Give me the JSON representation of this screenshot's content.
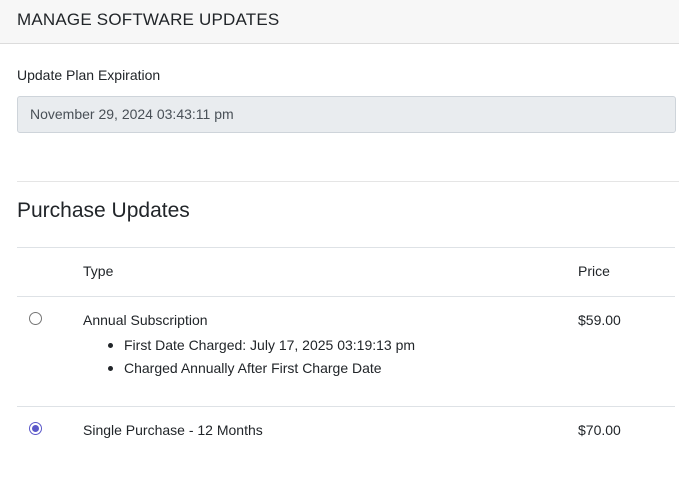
{
  "header": {
    "title": "MANAGE SOFTWARE UPDATES"
  },
  "expiration": {
    "label": "Update Plan Expiration",
    "value": "November 29, 2024 03:43:11 pm"
  },
  "purchase": {
    "title": "Purchase Updates",
    "columns": {
      "type": "Type",
      "price": "Price"
    },
    "options": [
      {
        "name": "Annual Subscription",
        "price": "$59.00",
        "selected": false,
        "details": [
          "First Date Charged: July 17, 2025 03:19:13 pm",
          "Charged Annually After First Charge Date"
        ]
      },
      {
        "name": "Single Purchase - 12 Months",
        "price": "$70.00",
        "selected": true
      }
    ]
  },
  "colors": {
    "accent": "#5b58c9",
    "field_bg": "#e9ecef"
  }
}
